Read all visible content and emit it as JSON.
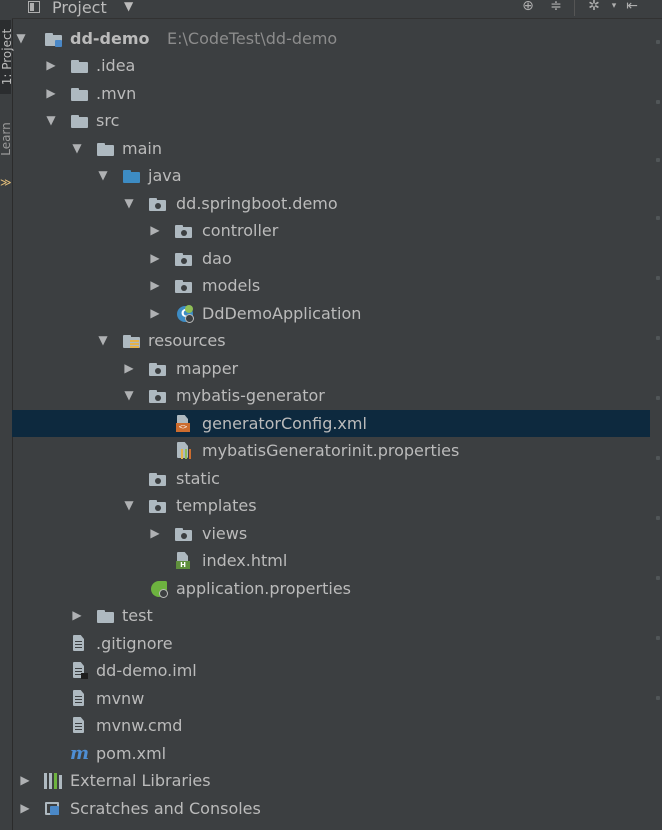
{
  "header": {
    "title": "Project",
    "icons": [
      "target-icon",
      "collapse-icon",
      "gear-icon",
      "hide-icon"
    ]
  },
  "side_strip": {
    "tab1": "1: Project",
    "tab2": "Learn"
  },
  "tree": {
    "rows": [
      {
        "label": "dd-demo",
        "path": "E:\\CodeTest\\dd-demo"
      },
      {
        "label": ".idea"
      },
      {
        "label": ".mvn"
      },
      {
        "label": "src"
      },
      {
        "label": "main"
      },
      {
        "label": "java"
      },
      {
        "label": "dd.springboot.demo"
      },
      {
        "label": "controller"
      },
      {
        "label": "dao"
      },
      {
        "label": "models"
      },
      {
        "label": "DdDemoApplication"
      },
      {
        "label": "resources"
      },
      {
        "label": "mapper"
      },
      {
        "label": "mybatis-generator"
      },
      {
        "label": "generatorConfig.xml"
      },
      {
        "label": "mybatisGeneratorinit.properties"
      },
      {
        "label": "static"
      },
      {
        "label": "templates"
      },
      {
        "label": "views"
      },
      {
        "label": "index.html"
      },
      {
        "label": "application.properties"
      },
      {
        "label": "test"
      },
      {
        "label": ".gitignore"
      },
      {
        "label": "dd-demo.iml"
      },
      {
        "label": "mvnw"
      },
      {
        "label": "mvnw.cmd"
      },
      {
        "label": "pom.xml"
      },
      {
        "label": "External Libraries"
      },
      {
        "label": "Scratches and Consoles"
      }
    ]
  },
  "colors": {
    "background": "#3c3f41",
    "selection": "#0d293e",
    "text": "#bbbbbb",
    "path": "#8c8c8c",
    "folder": "#aeb9c0",
    "source_folder": "#3d8cc4"
  }
}
